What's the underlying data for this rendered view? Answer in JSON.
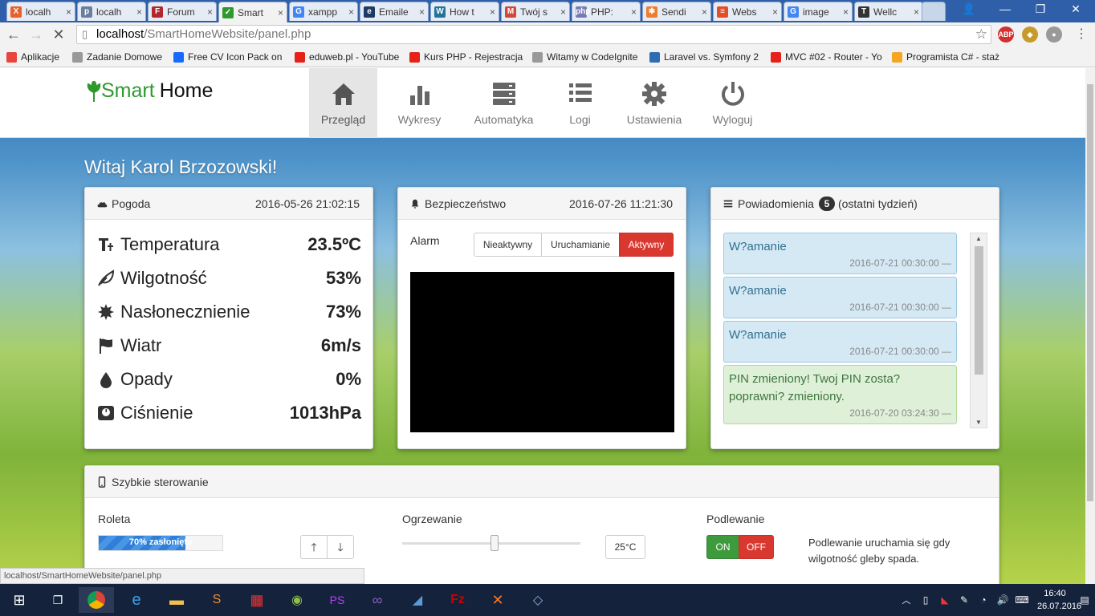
{
  "browser": {
    "tabs": [
      {
        "label": "localh",
        "color": "#e8602a",
        "glyph": "X"
      },
      {
        "label": "localh",
        "color": "#6a7fa0",
        "glyph": "p"
      },
      {
        "label": "Forum",
        "color": "#b0282d",
        "glyph": "F"
      },
      {
        "label": "Smart",
        "color": "#2e9a2e",
        "glyph": "✓"
      },
      {
        "label": "xampp",
        "color": "#4285f4",
        "glyph": "G"
      },
      {
        "label": "Emaile",
        "color": "#1f3a66",
        "glyph": "e"
      },
      {
        "label": "How t",
        "color": "#21759b",
        "glyph": "W"
      },
      {
        "label": "Twój s",
        "color": "#d44638",
        "glyph": "M"
      },
      {
        "label": "PHP: ",
        "color": "#777bb3",
        "glyph": "php"
      },
      {
        "label": "Sendi",
        "color": "#ee7d2f",
        "glyph": "✱"
      },
      {
        "label": "Webs",
        "color": "#e44d26",
        "glyph": "≡"
      },
      {
        "label": "image",
        "color": "#4285f4",
        "glyph": "G"
      },
      {
        "label": "Wellc",
        "color": "#333333",
        "glyph": "T"
      }
    ],
    "url_host": "localhost",
    "url_path": "/SmartHomeWebsite/panel.php",
    "bookmarks": [
      {
        "label": "Aplikacje",
        "color": "#e8453c"
      },
      {
        "label": "Zadanie Domowe",
        "color": "#999999"
      },
      {
        "label": "Free CV Icon Pack on",
        "color": "#1769ff"
      },
      {
        "label": "eduweb.pl - YouTube",
        "color": "#e62117"
      },
      {
        "label": "Kurs PHP - Rejestracja",
        "color": "#e62117"
      },
      {
        "label": "Witamy w CodeIgnite",
        "color": "#999999"
      },
      {
        "label": "Laravel vs. Symfony 2",
        "color": "#2e6db4"
      },
      {
        "label": "MVC #02 - Router - Yo",
        "color": "#e62117"
      },
      {
        "label": "Programista C# - staż",
        "color": "#f5a623"
      }
    ],
    "status_url": "localhost/SmartHomeWebsite/panel.php"
  },
  "site": {
    "logo_smart": "Smart",
    "logo_home": "Home",
    "nav": [
      {
        "label": "Przegląd",
        "icon": "home-icon"
      },
      {
        "label": "Wykresy",
        "icon": "bar-chart-icon"
      },
      {
        "label": "Automatyka",
        "icon": "server-icon"
      },
      {
        "label": "Logi",
        "icon": "list-icon"
      },
      {
        "label": "Ustawienia",
        "icon": "gear-icon"
      },
      {
        "label": "Wyloguj",
        "icon": "power-icon"
      }
    ],
    "greeting": "Witaj Karol Brzozowski!"
  },
  "weather": {
    "title": "Pogoda",
    "date": "2016-05-26 21:02:15",
    "rows": [
      {
        "label": "Temperatura",
        "value": "23.5ºC",
        "icon": "thermometer-icon"
      },
      {
        "label": "Wilgotność",
        "value": "53%",
        "icon": "leaf-icon"
      },
      {
        "label": "Nasłonecznienie",
        "value": "73%",
        "icon": "sun-icon"
      },
      {
        "label": "Wiatr",
        "value": "6m/s",
        "icon": "flag-icon"
      },
      {
        "label": "Opady",
        "value": "0%",
        "icon": "drop-icon"
      },
      {
        "label": "Ciśnienie",
        "value": "1013hPa",
        "icon": "scale-icon"
      }
    ]
  },
  "security": {
    "title": "Bezpieczeństwo",
    "date": "2016-07-26 11:21:30",
    "alarm_label": "Alarm",
    "buttons": [
      "Nieaktywny",
      "Uruchamianie",
      "Aktywny"
    ],
    "active_color": "#d9382f"
  },
  "notifications": {
    "title": "Powiadomienia",
    "count": "5",
    "suffix": "(ostatni tydzień)",
    "items": [
      {
        "text": "W?amanie",
        "date": "2016-07-21 00:30:00 —",
        "kind": "blue"
      },
      {
        "text": "W?amanie",
        "date": "2016-07-21 00:30:00 —",
        "kind": "blue"
      },
      {
        "text": "W?amanie",
        "date": "2016-07-21 00:30:00 —",
        "kind": "blue"
      },
      {
        "text": "PIN zmieniony! Twoj PIN zosta? poprawni? zmieniony.",
        "date": "2016-07-20 03:24:30 —",
        "kind": "green"
      }
    ]
  },
  "quick": {
    "title": "Szybkie sterowanie",
    "blind_label": "Roleta",
    "blind_progress_text": "70% zasłonięte",
    "blind_progress": 0.7,
    "heating_label": "Ogrzewanie",
    "heating_value": "25",
    "heating_unit": "°C",
    "heating_slider": 0.52,
    "watering_label": "Podlewanie",
    "on": "ON",
    "off": "OFF",
    "watering_note": "Podlewanie uruchamia się gdy wilgotność gleby spada."
  },
  "taskbar": {
    "time": "16:40",
    "date": "26.07.2016"
  }
}
